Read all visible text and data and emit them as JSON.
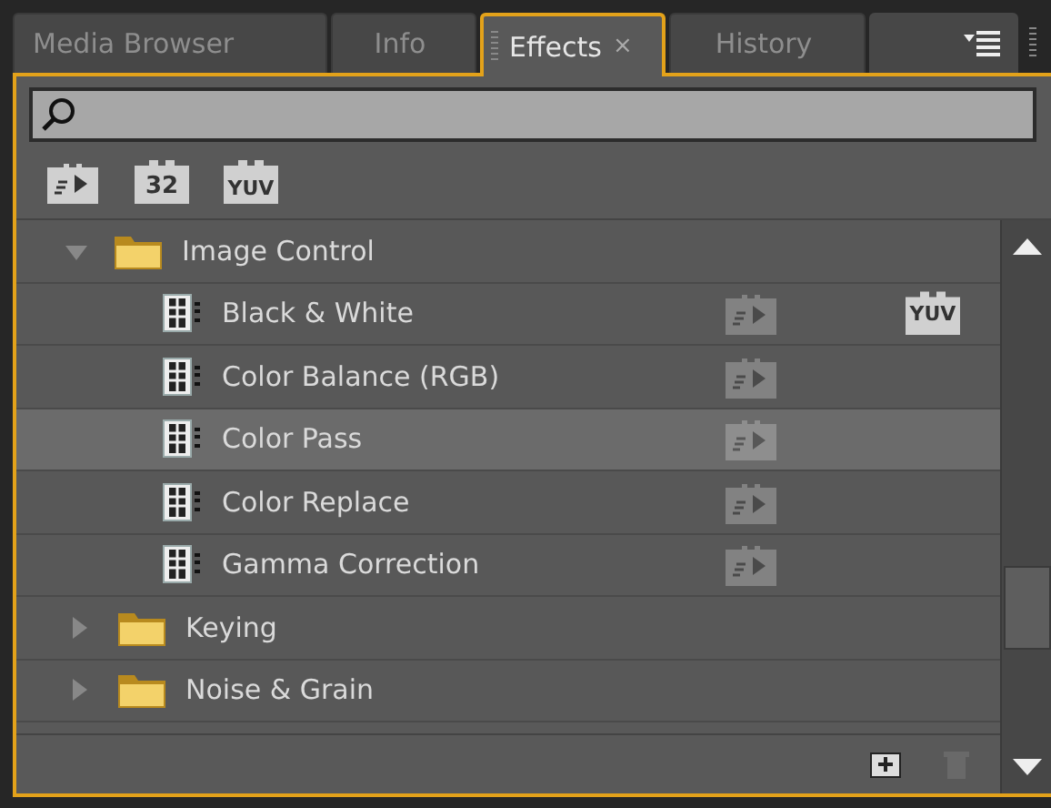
{
  "tabs": [
    {
      "label": "Media Browser",
      "selected": false
    },
    {
      "label": "Info",
      "selected": false
    },
    {
      "label": "Effects",
      "selected": true,
      "close_glyph": "×"
    },
    {
      "label": "History",
      "selected": false
    }
  ],
  "filters": [
    {
      "kind": "accelerated"
    },
    {
      "kind": "label",
      "label": "32"
    },
    {
      "kind": "label",
      "label": "YUV"
    }
  ],
  "tree": [
    {
      "label": "Image Control",
      "expanded": true,
      "selected": false,
      "children": [
        {
          "label": "Black & White",
          "selected": false,
          "accelerated": true,
          "yuv_badge": "YUV"
        },
        {
          "label": "Color Balance (RGB)",
          "selected": false,
          "accelerated": true
        },
        {
          "label": "Color Pass",
          "selected": true,
          "accelerated": true
        },
        {
          "label": "Color Replace",
          "selected": false,
          "accelerated": true
        },
        {
          "label": "Gamma Correction",
          "selected": false,
          "accelerated": true
        }
      ]
    },
    {
      "label": "Keying",
      "expanded": false,
      "selected": false
    },
    {
      "label": "Noise & Grain",
      "expanded": false,
      "selected": false
    }
  ]
}
